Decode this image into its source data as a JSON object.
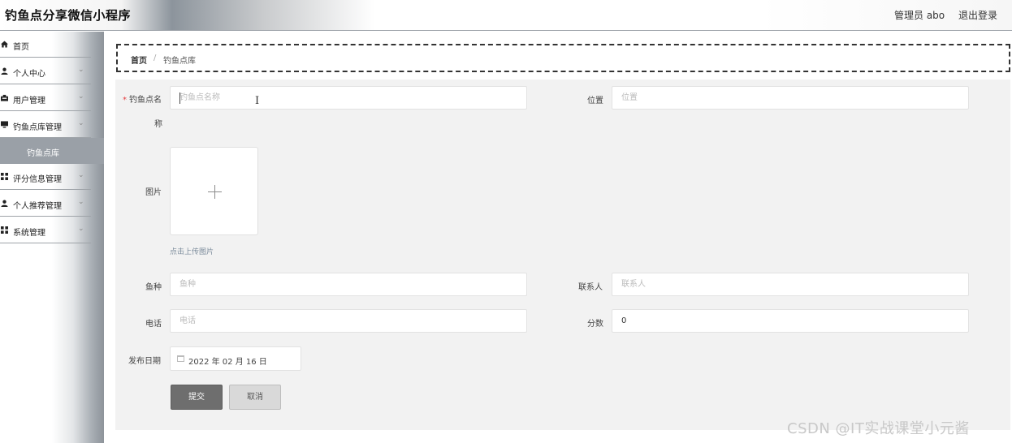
{
  "header": {
    "app_title": "钓鱼点分享微信小程序",
    "user_name": "管理员 abo",
    "logout_label": "退出登录"
  },
  "sidebar": {
    "items": [
      {
        "label": "首页",
        "icon": "home-icon"
      },
      {
        "label": "个人中心",
        "icon": "person-icon"
      },
      {
        "label": "用户管理",
        "icon": "user-manage-icon"
      },
      {
        "label": "钓鱼点库管理",
        "icon": "monitor-icon"
      },
      {
        "label": "钓鱼点库",
        "icon": ""
      },
      {
        "label": "评分信息管理",
        "icon": "grid-icon"
      },
      {
        "label": "个人推荐管理",
        "icon": "person-icon"
      },
      {
        "label": "系统管理",
        "icon": "grid-icon"
      }
    ]
  },
  "breadcrumb": {
    "home": "首页",
    "separator": "/",
    "current": "钓鱼点库"
  },
  "form": {
    "spot_name": {
      "label_1": "钓鱼点名",
      "label_2": "称",
      "required_mark": "*",
      "placeholder": "钓鱼点名称"
    },
    "location": {
      "label": "位置",
      "placeholder": "位置"
    },
    "image": {
      "label": "图片",
      "tip": "点击上传图片"
    },
    "fish_species": {
      "label": "鱼种",
      "placeholder": "鱼种"
    },
    "contact": {
      "label": "联系人",
      "placeholder": "联系人"
    },
    "phone": {
      "label": "电话",
      "placeholder": "电话"
    },
    "score": {
      "label": "分数",
      "value": "0"
    },
    "publish_date": {
      "label": "发布日期",
      "value": "2022 年 02 月 16 日"
    },
    "submit_label": "提交",
    "cancel_label": "取消"
  },
  "watermark": "CSDN @IT实战课堂小元酱",
  "colors": {
    "required": "#e4393c",
    "submit_bg": "#6e6e6e",
    "cancel_bg": "#d9d9d9",
    "sidebar_active": "#9aa0a7",
    "panel_bg": "#f2f2f2"
  }
}
